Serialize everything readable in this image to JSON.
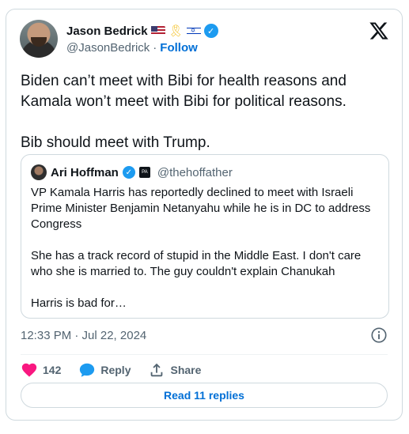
{
  "author": {
    "name": "Jason Bedrick",
    "handle": "@JasonBedrick",
    "separator": "·",
    "follow_label": "Follow"
  },
  "tweet": {
    "text": "Biden can’t meet with Bibi for health reasons and Kamala won’t meet with Bibi for political reasons.\n\nBib should meet with Trump.",
    "timestamp": "12:33 PM · Jul 22, 2024"
  },
  "quote": {
    "name": "Ari Hoffman",
    "badge": "PA",
    "handle": "@thehoffather",
    "text": "VP Kamala Harris has  reportedly declined to meet with Israeli Prime Minister Benjamin Netanyahu while he is in DC to address Congress\n\nShe has a track record of stupid in the Middle East. I don't care who she is married to. The guy couldn't explain Chanukah\n\nHarris is bad for…"
  },
  "actions": {
    "like_count": "142",
    "reply_label": "Reply",
    "share_label": "Share"
  },
  "read_replies_label": "Read 11 replies",
  "colors": {
    "like": "#f91880",
    "reply": "#1d9bf0",
    "link": "#006fd6",
    "verified": "#1d9bf0"
  },
  "icons": [
    "x-logo-icon",
    "verified-icon",
    "heart-icon",
    "reply-bubble-icon",
    "share-icon",
    "info-icon"
  ]
}
